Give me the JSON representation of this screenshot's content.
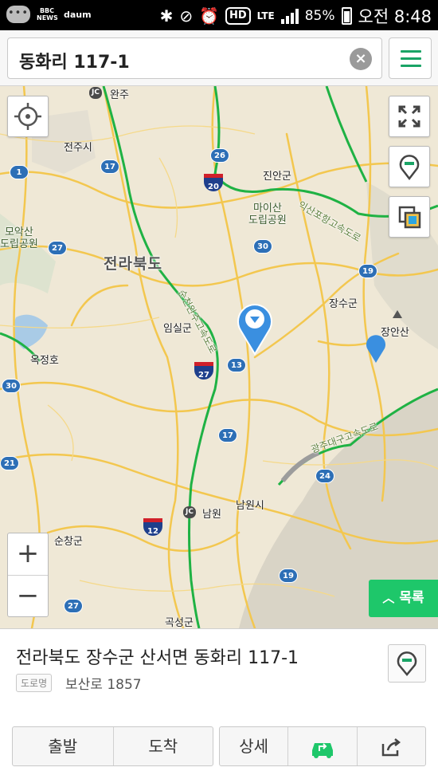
{
  "status_bar": {
    "news_label": "BBC NEWS",
    "app_label": "daum",
    "network": "LTE",
    "hd": "HD",
    "battery": "85%",
    "time": "오전 8:48"
  },
  "search": {
    "query": "동화리 117-1",
    "clear_icon": "×"
  },
  "map": {
    "labels": {
      "jeonju": "전주시",
      "wanju": "완주",
      "jinan": "진안군",
      "maisan": "마이산\n도립공원",
      "moaksan": "모악산\n도립공원",
      "province": "전라북도",
      "imsil": "임실군",
      "jangsu": "장수군",
      "jangansan": "장안산",
      "okjeongho": "옥정호",
      "namwon_city": "남원시",
      "namwon_jc": "남원",
      "sunchang": "순창군",
      "gokseong": "곡성군",
      "expwy_iksan": "익산포항고속도로",
      "expwy_sunchang": "순천완주고속도로",
      "expwy_gwangju": "광주대구고속도로",
      "jc": "JC"
    },
    "route_shields": [
      "1",
      "17",
      "26",
      "20",
      "30",
      "27",
      "19",
      "13",
      "27",
      "30",
      "17",
      "24",
      "21",
      "12",
      "19",
      "27"
    ],
    "zoom_in": "+",
    "zoom_out": "−",
    "list_button": "목록"
  },
  "info": {
    "address": "전라북도 장수군 산서면 동화리 117-1",
    "road_tag": "도로명",
    "road_address": "보산로 1857"
  },
  "actions": {
    "departure": "출발",
    "arrival": "도착",
    "detail": "상세"
  },
  "colors": {
    "accent_green": "#1ec76a",
    "pin_blue": "#3a8fe0"
  }
}
